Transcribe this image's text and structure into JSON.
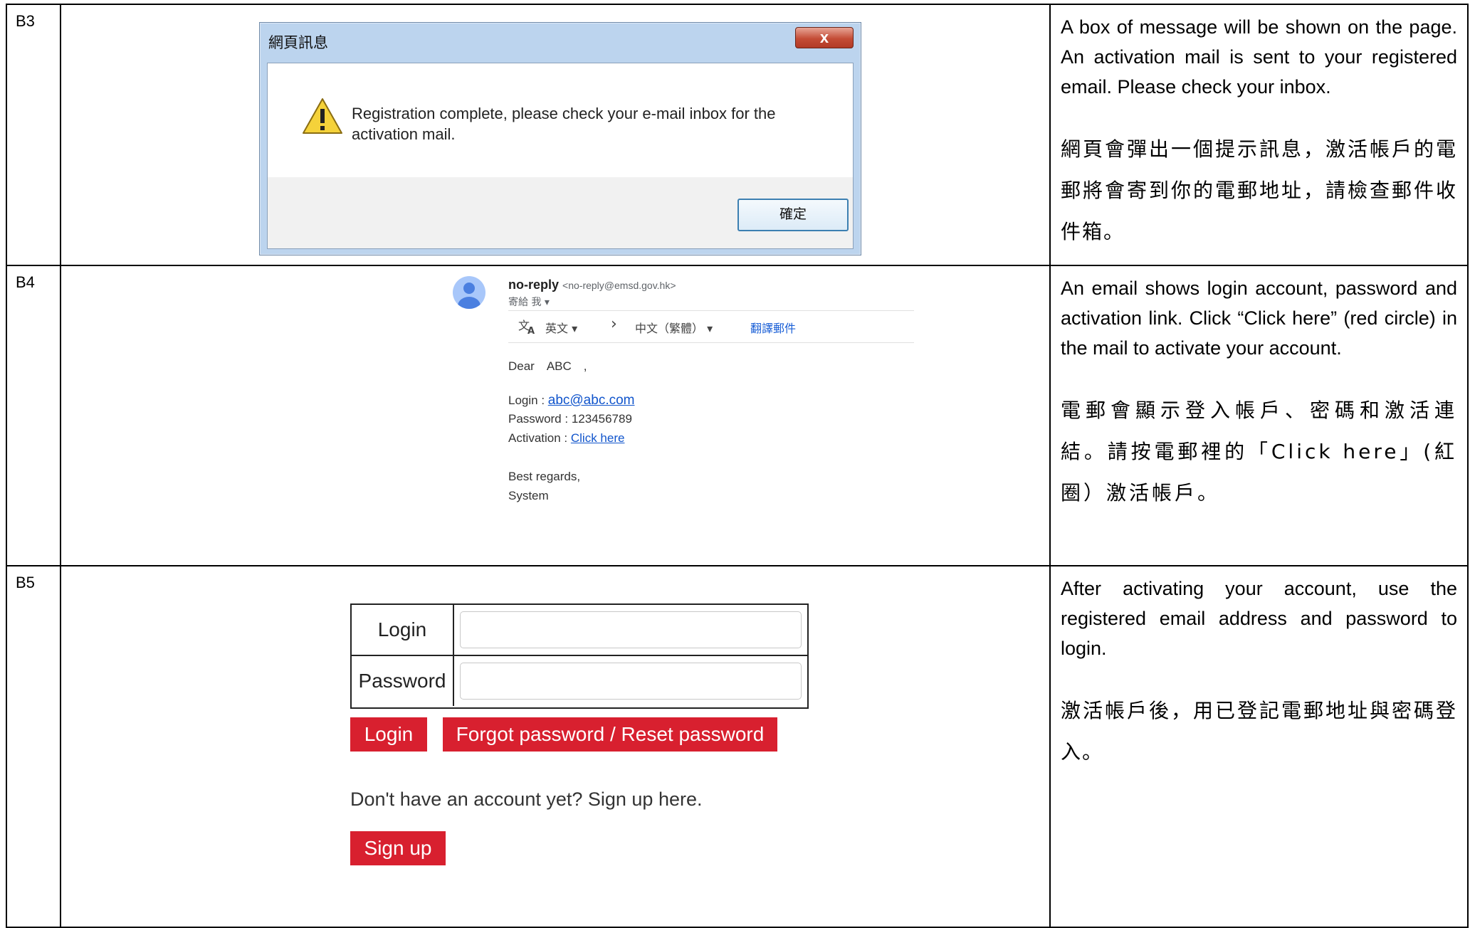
{
  "rows": [
    {
      "step": "B3",
      "dialog": {
        "title": "網頁訊息",
        "close_glyph": "x",
        "message_line1": "Registration complete, please check your e-mail inbox for the",
        "message_line2": "activation mail.",
        "ok_label": "確定",
        "icon": "warning-triangle-icon"
      },
      "desc_en": "A box of message will be shown on the page. An activation mail is sent to your registered email. Please check your inbox.",
      "desc_zh": "網頁會彈出一個提示訊息，激活帳戶的電郵將會寄到你的電郵地址，請檢查郵件收件箱。"
    },
    {
      "step": "B4",
      "email": {
        "sender_name": "no-reply",
        "sender_address": "<no-reply@emsd.gov.hk>",
        "to_line": "寄給 我 ▾",
        "translate_from": "英文 ▾",
        "translate_arrow": "›",
        "translate_to": "中文（繁體） ▾",
        "translate_link": "翻譯郵件",
        "greeting": "Dear　ABC　,",
        "login_label": "Login : ",
        "login_value": "abc@abc.com",
        "password_label": "Password : ",
        "password_value": "123456789",
        "activation_label": "Activation : ",
        "activation_link": "Click here",
        "regards": "Best regards,",
        "signature": "System"
      },
      "desc_en": "An email shows login account, password and activation link. Click “Click here” (red circle) in the mail to activate your account.",
      "desc_zh": "電郵會顯示登入帳戶、密碼和激活連結。請按電郵裡的「Click here」(紅圈）激活帳戶。"
    },
    {
      "step": "B5",
      "login_form": {
        "login_label": "Login",
        "password_label": "Password",
        "login_button": "Login",
        "forgot_button": "Forgot password / Reset password",
        "signup_prompt": "Don't have an account yet? Sign up here.",
        "signup_button": "Sign up"
      },
      "desc_en": "After activating your account, use the registered email address and password to login.",
      "desc_zh": "激活帳戶後，用已登記電郵地址與密碼登入。"
    }
  ],
  "colors": {
    "button_red": "#d8202f",
    "link_blue": "#1155cc"
  }
}
